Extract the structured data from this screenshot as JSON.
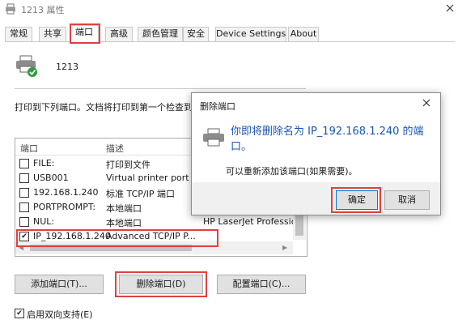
{
  "window": {
    "title": "1213 属性"
  },
  "tabs": [
    "常规",
    "共享",
    "端口",
    "高级",
    "颜色管理",
    "安全",
    "Device Settings",
    "About"
  ],
  "printer": {
    "name": "1213"
  },
  "ports_section": {
    "instruction": "打印到下列端口。文档将打印到第一个检查到的",
    "columns": [
      "端口",
      "描述"
    ],
    "rows": [
      {
        "port": "FILE:",
        "desc": "打印到文件",
        "printer": "",
        "checked": false
      },
      {
        "port": "USB001",
        "desc": "Virtual printer port ...",
        "printer": "",
        "checked": false
      },
      {
        "port": "192.168.1.240",
        "desc": "标准 TCP/IP 端口",
        "printer": "",
        "checked": false
      },
      {
        "port": "PORTPROMPT:",
        "desc": "本地端口",
        "printer": "",
        "checked": false
      },
      {
        "port": "NUL:",
        "desc": "本地端口",
        "printer": "HP LaserJet Professior",
        "checked": false
      },
      {
        "port": "IP_192.168.1.240",
        "desc": "Advanced TCP/IP P...",
        "printer": "",
        "checked": true
      }
    ],
    "buttons": {
      "add": "添加端口(T)...",
      "delete": "删除端口(D)",
      "configure": "配置端口(C)..."
    },
    "bidirectional": {
      "label": "启用双向支持(E)",
      "checked": true
    }
  },
  "dialog": {
    "title": "删除端口",
    "message": "你即将删除名为 IP_192.168.1.240 的端口。",
    "sub": "可以重新添加该端口(如果需要)。",
    "ok": "确定",
    "cancel": "取消"
  },
  "highlight_color": "#e04040"
}
